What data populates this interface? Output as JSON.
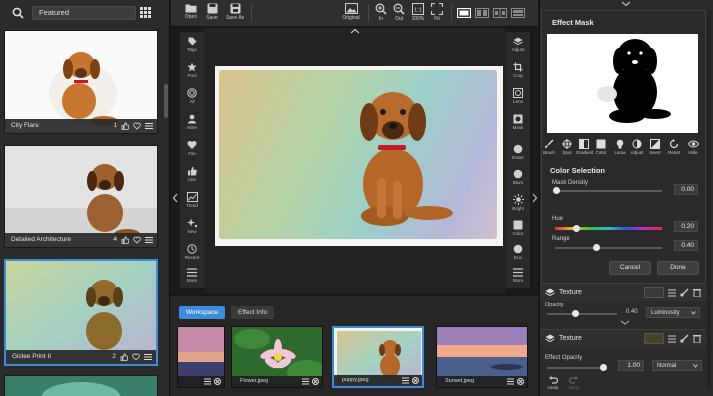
{
  "presets": {
    "search_value": "Featured",
    "items": [
      {
        "name": "City Flare",
        "likes": "1"
      },
      {
        "name": "Detailed Architecture",
        "likes": "4"
      },
      {
        "name": "Giclee Print II",
        "likes": "2"
      }
    ]
  },
  "toolbar": {
    "open": "Open",
    "save": "Save",
    "save_as": "Save As",
    "original": "Original",
    "zoom_in": "In",
    "zoom_out": "Out",
    "zoom_100": "100%",
    "fit": "Fit"
  },
  "left_tools": [
    "Tags",
    "Pool",
    "All",
    "Mine",
    "Fav",
    "Like",
    "Trend",
    "New",
    "Recent",
    "More"
  ],
  "right_tools": [
    "Adjust",
    "Crop",
    "Lens",
    "Mask",
    "Erase",
    "Blurs",
    "Bright",
    "Color",
    "Duo",
    "More"
  ],
  "filmstrip": {
    "tab_workspace": "Workspace",
    "tab_effect_info": "Effect Info",
    "items": [
      "",
      "Flower.jpeg",
      "puppy.jpeg",
      "Sunset.jpeg"
    ]
  },
  "effect_mask": {
    "title": "Effect Mask",
    "tools": [
      "Brush",
      "Spot",
      "Gradient",
      "Color",
      "Luma",
      "Adjust",
      "Invert",
      "Reset",
      "Hide"
    ],
    "color_selection_title": "Color Selection",
    "mask_density_label": "Mask Density",
    "mask_density_value": "0.00",
    "hue_label": "Hue",
    "hue_value": "0.20",
    "range_label": "Range",
    "range_value": "0.40",
    "cancel": "Cancel",
    "done": "Done"
  },
  "layers": [
    {
      "name": "Texture",
      "opacity_label": "Opacity",
      "opacity_value": "0.40",
      "blend": "Luminosity"
    },
    {
      "name": "Texture",
      "opacity_label": "Effect Opacity",
      "opacity_value": "1.00",
      "blend": "Normal"
    }
  ],
  "history": {
    "undo": "Undo",
    "redo": "Redo"
  },
  "colors": {
    "accent": "#3b8ddc",
    "panel": "#2b2b2b",
    "mask_fill": "#000000"
  }
}
